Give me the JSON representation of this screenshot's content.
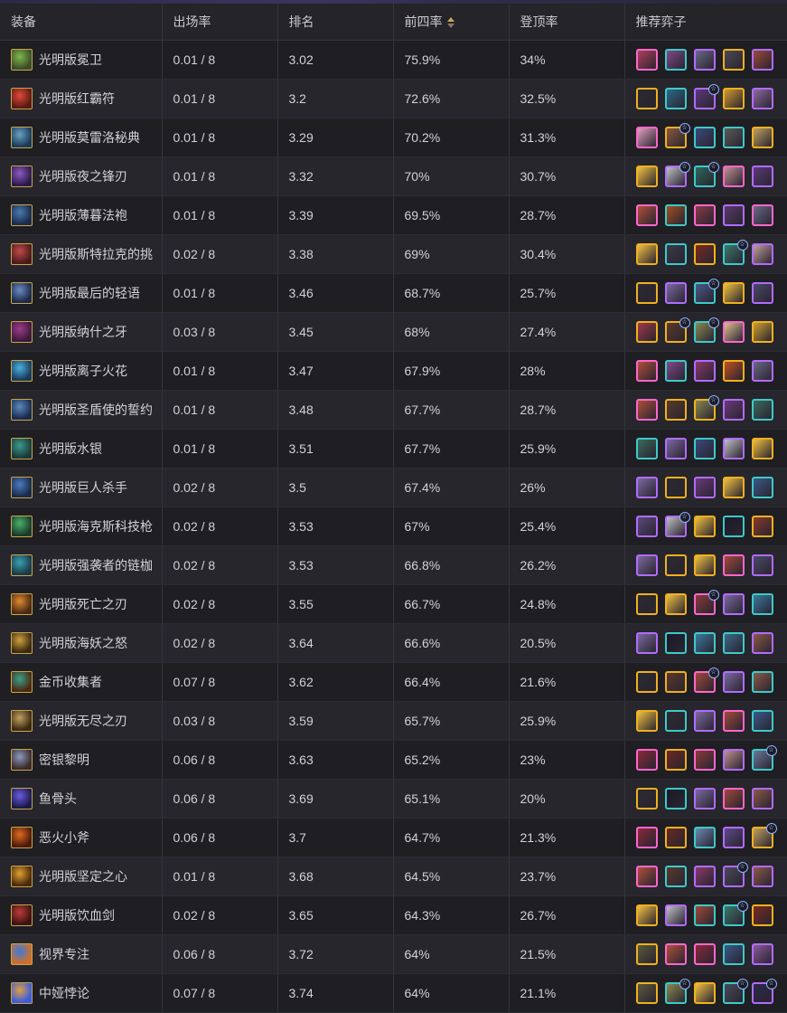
{
  "table": {
    "headers": {
      "item": "装备",
      "play_rate": "出场率",
      "rank": "排名",
      "top4": "前四率",
      "top1": "登顶率",
      "champs": "推荐弈子"
    },
    "sorted_column": "top4",
    "rows": [
      {
        "item": "光明版冕卫",
        "play_rate": "0.01 / 8",
        "rank": "3.02",
        "top4": "75.9%",
        "top1": "34%",
        "icon_colors": [
          "#7fb84a",
          "#3a4d2a"
        ],
        "champs": [
          {
            "c": "#b0405a",
            "b": "#ff66cc"
          },
          {
            "c": "#7f4a8a",
            "b": "#3ec9c9"
          },
          {
            "c": "#6a6a88",
            "b": "#b26bff"
          },
          {
            "c": "#4a4a55",
            "b": "#f0b020"
          },
          {
            "c": "#9a4a3a",
            "b": "#b26bff"
          }
        ]
      },
      {
        "item": "光明版红霸符",
        "play_rate": "0.01 / 8",
        "rank": "3.2",
        "top4": "72.6%",
        "top1": "32.5%",
        "icon_colors": [
          "#e04a3a",
          "#5a1a12"
        ],
        "champs": [
          {
            "c": "#2a2a30",
            "b": "#f0b020"
          },
          {
            "c": "#2a6a8a",
            "b": "#3ec9c9"
          },
          {
            "c": "#5a3a7a",
            "b": "#b26bff",
            "s": true
          },
          {
            "c": "#d09a30",
            "b": "#f0b020"
          },
          {
            "c": "#8a6aa0",
            "b": "#b26bff"
          }
        ]
      },
      {
        "item": "光明版莫雷洛秘典",
        "play_rate": "0.01 / 8",
        "rank": "3.29",
        "top4": "70.2%",
        "top1": "31.3%",
        "icon_colors": [
          "#6aa0c0",
          "#1a3a5a"
        ],
        "champs": [
          {
            "c": "#e0a0c0",
            "b": "#ff66cc"
          },
          {
            "c": "#8a5a3a",
            "b": "#f0b020",
            "s": true
          },
          {
            "c": "#3a4a7a",
            "b": "#3ec9c9"
          },
          {
            "c": "#5a5a5a",
            "b": "#3ec9c9"
          },
          {
            "c": "#c0a060",
            "b": "#f0b020"
          }
        ]
      },
      {
        "item": "光明版夜之锋刃",
        "play_rate": "0.01 / 8",
        "rank": "3.32",
        "top4": "70%",
        "top1": "30.7%",
        "icon_colors": [
          "#8a5ac0",
          "#2a1a4a"
        ],
        "champs": [
          {
            "c": "#f0c040",
            "b": "#f0b020"
          },
          {
            "c": "#c0c0c8",
            "b": "#b26bff",
            "s": true
          },
          {
            "c": "#2a6a5a",
            "b": "#3ec9c9",
            "s": true
          },
          {
            "c": "#c09090",
            "b": "#ff66cc"
          },
          {
            "c": "#5a3a7a",
            "b": "#b26bff"
          }
        ]
      },
      {
        "item": "光明版薄暮法袍",
        "play_rate": "0.01 / 8",
        "rank": "3.39",
        "top4": "69.5%",
        "top1": "28.7%",
        "icon_colors": [
          "#4a7ab0",
          "#1a2a4a"
        ],
        "champs": [
          {
            "c": "#b0503a",
            "b": "#ff66cc"
          },
          {
            "c": "#a05020",
            "b": "#3ec9c9"
          },
          {
            "c": "#8a3a4a",
            "b": "#ff66cc"
          },
          {
            "c": "#5a3a6a",
            "b": "#b26bff"
          },
          {
            "c": "#6a6a88",
            "b": "#ff66cc"
          }
        ]
      },
      {
        "item": "光明版斯特拉克的挑",
        "play_rate": "0.02 / 8",
        "rank": "3.38",
        "top4": "69%",
        "top1": "30.4%",
        "icon_colors": [
          "#c04a4a",
          "#4a1a1a"
        ],
        "champs": [
          {
            "c": "#f0c040",
            "b": "#f0b020"
          },
          {
            "c": "#3a3a4a",
            "b": "#3ec9c9"
          },
          {
            "c": "#7a2a20",
            "b": "#f0b020"
          },
          {
            "c": "#3a7a6a",
            "b": "#3ec9c9",
            "s": true
          },
          {
            "c": "#c0a0a0",
            "b": "#b26bff"
          }
        ]
      },
      {
        "item": "光明版最后的轻语",
        "play_rate": "0.01 / 8",
        "rank": "3.46",
        "top4": "68.7%",
        "top1": "25.7%",
        "icon_colors": [
          "#6a8ac0",
          "#1a2a4a"
        ],
        "champs": [
          {
            "c": "#2a2a30",
            "b": "#f0b020"
          },
          {
            "c": "#7a6aa0",
            "b": "#b26bff"
          },
          {
            "c": "#4a5a8a",
            "b": "#3ec9c9",
            "s": true
          },
          {
            "c": "#f0c040",
            "b": "#f0b020"
          },
          {
            "c": "#4a4a6a",
            "b": "#b26bff"
          }
        ]
      },
      {
        "item": "光明版纳什之牙",
        "play_rate": "0.03 / 8",
        "rank": "3.45",
        "top4": "68%",
        "top1": "27.4%",
        "icon_colors": [
          "#a03a8a",
          "#3a1a3a"
        ],
        "champs": [
          {
            "c": "#a03a4a",
            "b": "#f0b020"
          },
          {
            "c": "#5a3a2a",
            "b": "#f0b020",
            "s": true
          },
          {
            "c": "#8a8a50",
            "b": "#3ec9c9",
            "s": true
          },
          {
            "c": "#e0c090",
            "b": "#ff66cc"
          },
          {
            "c": "#d0a030",
            "b": "#f0b020"
          }
        ]
      },
      {
        "item": "光明版离子火花",
        "play_rate": "0.01 / 8",
        "rank": "3.47",
        "top4": "67.9%",
        "top1": "28%",
        "icon_colors": [
          "#4ab0e0",
          "#1a3a5a"
        ],
        "champs": [
          {
            "c": "#b0503a",
            "b": "#ff66cc"
          },
          {
            "c": "#7f4a8a",
            "b": "#3ec9c9"
          },
          {
            "c": "#8a3a6a",
            "b": "#b26bff"
          },
          {
            "c": "#c05020",
            "b": "#f0b020"
          },
          {
            "c": "#6a6a88",
            "b": "#b26bff"
          }
        ]
      },
      {
        "item": "光明版圣盾使的誓约",
        "play_rate": "0.01 / 8",
        "rank": "3.48",
        "top4": "67.7%",
        "top1": "28.7%",
        "icon_colors": [
          "#5a8ac0",
          "#1a2a4a"
        ],
        "champs": [
          {
            "c": "#b0503a",
            "b": "#ff66cc"
          },
          {
            "c": "#5a3a2a",
            "b": "#f0b020"
          },
          {
            "c": "#8a8a50",
            "b": "#f0b020",
            "s": true
          },
          {
            "c": "#6a3a7a",
            "b": "#b26bff"
          },
          {
            "c": "#3a6a5a",
            "b": "#3ec9c9"
          }
        ]
      },
      {
        "item": "光明版水银",
        "play_rate": "0.01 / 8",
        "rank": "3.51",
        "top4": "67.7%",
        "top1": "25.9%",
        "icon_colors": [
          "#3a9a8a",
          "#1a3a3a"
        ],
        "champs": [
          {
            "c": "#3a6a5a",
            "b": "#3ec9c9"
          },
          {
            "c": "#7a6aa0",
            "b": "#b26bff"
          },
          {
            "c": "#3a4a7a",
            "b": "#3ec9c9"
          },
          {
            "c": "#c0c0c8",
            "b": "#b26bff"
          },
          {
            "c": "#f0c040",
            "b": "#f0b020"
          }
        ]
      },
      {
        "item": "光明版巨人杀手",
        "play_rate": "0.02 / 8",
        "rank": "3.5",
        "top4": "67.4%",
        "top1": "26%",
        "icon_colors": [
          "#4a7ac0",
          "#1a2a4a"
        ],
        "champs": [
          {
            "c": "#7a6aa0",
            "b": "#b26bff"
          },
          {
            "c": "#2a2a30",
            "b": "#f0b020"
          },
          {
            "c": "#6a3a7a",
            "b": "#b26bff"
          },
          {
            "c": "#f0c040",
            "b": "#f0b020"
          },
          {
            "c": "#3a5a8a",
            "b": "#3ec9c9"
          }
        ]
      },
      {
        "item": "光明版海克斯科技枪",
        "play_rate": "0.02 / 8",
        "rank": "3.53",
        "top4": "67%",
        "top1": "25.4%",
        "icon_colors": [
          "#4ab06a",
          "#1a3a2a"
        ],
        "champs": [
          {
            "c": "#5a4a7a",
            "b": "#b26bff"
          },
          {
            "c": "#c0c0c8",
            "b": "#b26bff",
            "s": true
          },
          {
            "c": "#f0c040",
            "b": "#f0b020"
          },
          {
            "c": "#1a1a2a",
            "b": "#3ec9c9"
          },
          {
            "c": "#8a3a2a",
            "b": "#f0b020"
          }
        ]
      },
      {
        "item": "光明版强袭者的链枷",
        "play_rate": "0.02 / 8",
        "rank": "3.53",
        "top4": "66.8%",
        "top1": "26.2%",
        "icon_colors": [
          "#3aa0b0",
          "#1a3a4a"
        ],
        "champs": [
          {
            "c": "#7a6aa0",
            "b": "#b26bff"
          },
          {
            "c": "#2a2a30",
            "b": "#f0b020"
          },
          {
            "c": "#f0c040",
            "b": "#f0b020"
          },
          {
            "c": "#a04a3a",
            "b": "#ff66cc"
          },
          {
            "c": "#4a4a6a",
            "b": "#b26bff"
          }
        ]
      },
      {
        "item": "光明版死亡之刃",
        "play_rate": "0.02 / 8",
        "rank": "3.55",
        "top4": "66.7%",
        "top1": "24.8%",
        "icon_colors": [
          "#e08a30",
          "#4a2a12"
        ],
        "champs": [
          {
            "c": "#2a2a30",
            "b": "#f0b020"
          },
          {
            "c": "#f0c040",
            "b": "#f0b020"
          },
          {
            "c": "#8a3a3a",
            "b": "#ff66cc",
            "s": true
          },
          {
            "c": "#7a6aa0",
            "b": "#b26bff"
          },
          {
            "c": "#3a7aa0",
            "b": "#3ec9c9"
          }
        ]
      },
      {
        "item": "光明版海妖之怒",
        "play_rate": "0.02 / 8",
        "rank": "3.64",
        "top4": "66.6%",
        "top1": "20.5%",
        "icon_colors": [
          "#d0a040",
          "#3a2a12"
        ],
        "champs": [
          {
            "c": "#7a6aa0",
            "b": "#b26bff"
          },
          {
            "c": "#1a1a2a",
            "b": "#3ec9c9"
          },
          {
            "c": "#3a7aa0",
            "b": "#3ec9c9"
          },
          {
            "c": "#3a6a8a",
            "b": "#3ec9c9"
          },
          {
            "c": "#8a5a4a",
            "b": "#b26bff"
          }
        ]
      },
      {
        "item": "金币收集者",
        "play_rate": "0.07 / 8",
        "rank": "3.62",
        "top4": "66.4%",
        "top1": "21.6%",
        "icon_colors": [
          "#3aa08a",
          "#4a2a12"
        ],
        "champs": [
          {
            "c": "#2a2a30",
            "b": "#f0b020"
          },
          {
            "c": "#5a3a2a",
            "b": "#f0b020"
          },
          {
            "c": "#a04a3a",
            "b": "#ff66cc",
            "s": true
          },
          {
            "c": "#7a6aa0",
            "b": "#b26bff"
          },
          {
            "c": "#8a5a4a",
            "b": "#3ec9c9"
          }
        ]
      },
      {
        "item": "光明版无尽之刃",
        "play_rate": "0.03 / 8",
        "rank": "3.59",
        "top4": "65.7%",
        "top1": "25.9%",
        "icon_colors": [
          "#c0a060",
          "#3a2a12"
        ],
        "champs": [
          {
            "c": "#f0c040",
            "b": "#f0b020"
          },
          {
            "c": "#2a2a30",
            "b": "#3ec9c9"
          },
          {
            "c": "#7a6aa0",
            "b": "#b26bff"
          },
          {
            "c": "#a04a3a",
            "b": "#ff66cc"
          },
          {
            "c": "#3a5a8a",
            "b": "#3ec9c9"
          }
        ]
      },
      {
        "item": "密银黎明",
        "play_rate": "0.06 / 8",
        "rank": "3.63",
        "top4": "65.2%",
        "top1": "23%",
        "icon_colors": [
          "#8a9ac0",
          "#3a2a2a"
        ],
        "champs": [
          {
            "c": "#8a2a3a",
            "b": "#ff66cc"
          },
          {
            "c": "#6a2a20",
            "b": "#f0b020"
          },
          {
            "c": "#8a3a3a",
            "b": "#ff66cc"
          },
          {
            "c": "#c09090",
            "b": "#b26bff"
          },
          {
            "c": "#6a7a9a",
            "b": "#3ec9c9",
            "s": true
          }
        ]
      },
      {
        "item": "鱼骨头",
        "play_rate": "0.06 / 8",
        "rank": "3.69",
        "top4": "65.1%",
        "top1": "20%",
        "icon_colors": [
          "#6a5ae0",
          "#1a1a4a"
        ],
        "champs": [
          {
            "c": "#2a2a30",
            "b": "#f0b020"
          },
          {
            "c": "#1a1a2a",
            "b": "#3ec9c9"
          },
          {
            "c": "#7a6aa0",
            "b": "#b26bff"
          },
          {
            "c": "#a04a3a",
            "b": "#ff66cc"
          },
          {
            "c": "#8a5a4a",
            "b": "#b26bff"
          }
        ]
      },
      {
        "item": "恶火小斧",
        "play_rate": "0.06 / 8",
        "rank": "3.7",
        "top4": "64.7%",
        "top1": "21.3%",
        "icon_colors": [
          "#e06a20",
          "#4a1a0a"
        ],
        "champs": [
          {
            "c": "#8a2a3a",
            "b": "#ff66cc"
          },
          {
            "c": "#6a2a20",
            "b": "#f0b020"
          },
          {
            "c": "#6a8ab0",
            "b": "#3ec9c9"
          },
          {
            "c": "#5a4a8a",
            "b": "#b26bff"
          },
          {
            "c": "#c0a060",
            "b": "#f0b020",
            "s": true
          }
        ]
      },
      {
        "item": "光明版坚定之心",
        "play_rate": "0.01 / 8",
        "rank": "3.68",
        "top4": "64.5%",
        "top1": "23.7%",
        "icon_colors": [
          "#e0a030",
          "#4a2a0a"
        ],
        "champs": [
          {
            "c": "#b0503a",
            "b": "#ff66cc"
          },
          {
            "c": "#5a3a2a",
            "b": "#3ec9c9"
          },
          {
            "c": "#8a3a6a",
            "b": "#b26bff"
          },
          {
            "c": "#4a4a5a",
            "b": "#b26bff",
            "s": true
          },
          {
            "c": "#8a5a4a",
            "b": "#b26bff"
          }
        ]
      },
      {
        "item": "光明版饮血剑",
        "play_rate": "0.02 / 8",
        "rank": "3.65",
        "top4": "64.3%",
        "top1": "26.7%",
        "icon_colors": [
          "#c03a3a",
          "#3a1212"
        ],
        "champs": [
          {
            "c": "#f0c040",
            "b": "#f0b020"
          },
          {
            "c": "#c0c0c8",
            "b": "#b26bff"
          },
          {
            "c": "#a04a3a",
            "b": "#3ec9c9"
          },
          {
            "c": "#3a7a6a",
            "b": "#3ec9c9",
            "s": true
          },
          {
            "c": "#7a2a20",
            "b": "#f0b020"
          }
        ]
      },
      {
        "item": "视界专注",
        "play_rate": "0.06 / 8",
        "rank": "3.72",
        "top4": "64%",
        "top1": "21.5%",
        "icon_colors": [
          "#3a7ae0",
          "#d0702a"
        ],
        "champs": [
          {
            "c": "#5a5a3a",
            "b": "#f0b020"
          },
          {
            "c": "#b0503a",
            "b": "#ff66cc"
          },
          {
            "c": "#8a2a3a",
            "b": "#ff66cc"
          },
          {
            "c": "#3a5a8a",
            "b": "#3ec9c9"
          },
          {
            "c": "#8a5a9a",
            "b": "#b26bff"
          }
        ]
      },
      {
        "item": "中娅悖论",
        "play_rate": "0.07 / 8",
        "rank": "3.74",
        "top4": "64%",
        "top1": "21.1%",
        "icon_colors": [
          "#e0a040",
          "#3a5ae0"
        ],
        "champs": [
          {
            "c": "#5a5a3a",
            "b": "#f0b020"
          },
          {
            "c": "#8a8a50",
            "b": "#3ec9c9",
            "s": true
          },
          {
            "c": "#f0c040",
            "b": "#f0b020"
          },
          {
            "c": "#4a4a5a",
            "b": "#3ec9c9",
            "s": true
          },
          {
            "c": "#2a2a4a",
            "b": "#b26bff",
            "s": true
          }
        ]
      }
    ]
  }
}
